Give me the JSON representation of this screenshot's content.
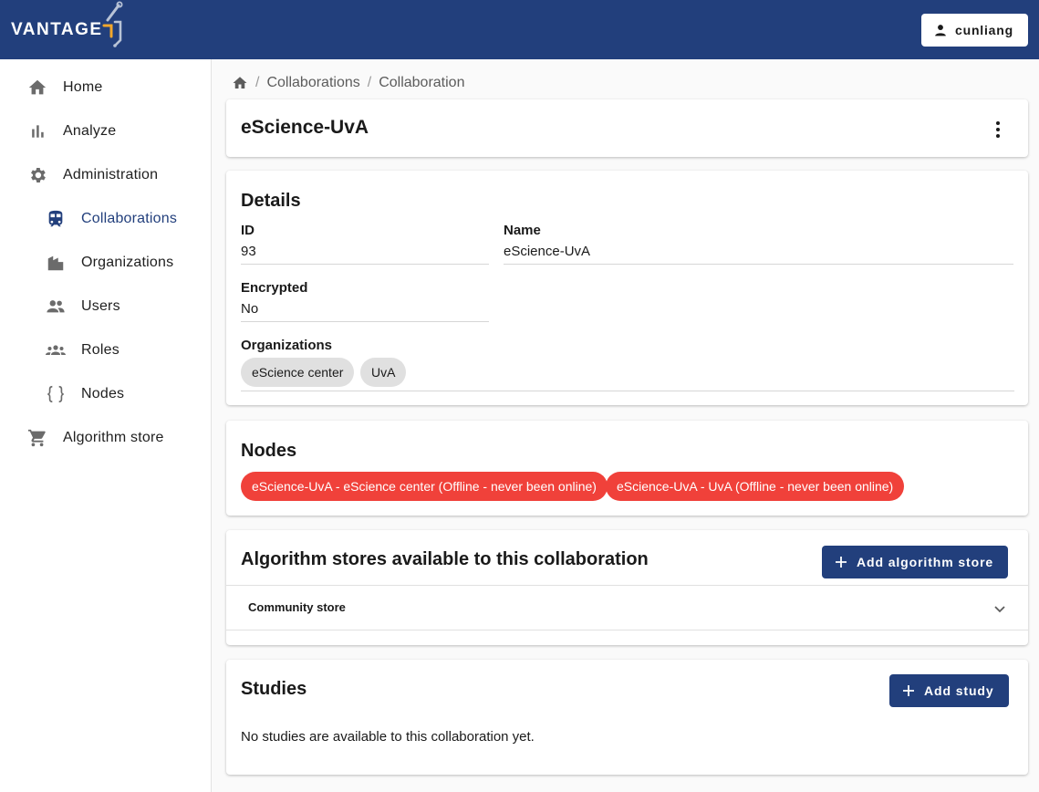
{
  "app": {
    "logo_text": "VANTAGE"
  },
  "header": {
    "user_label": "cunliang"
  },
  "colors": {
    "brand": "#223f7c",
    "offline": "#f0413a",
    "chip": "#e0e0e0"
  },
  "sidebar": {
    "items": [
      {
        "label": "Home",
        "icon": "home-icon"
      },
      {
        "label": "Analyze",
        "icon": "bar-chart-icon"
      },
      {
        "label": "Administration",
        "icon": "gear-icon"
      },
      {
        "label": "Collaborations",
        "icon": "train-icon",
        "active": true
      },
      {
        "label": "Organizations",
        "icon": "building-icon"
      },
      {
        "label": "Users",
        "icon": "people-icon"
      },
      {
        "label": "Roles",
        "icon": "groups-icon"
      },
      {
        "label": "Nodes",
        "icon": "braces-icon"
      },
      {
        "label": "Algorithm store",
        "icon": "cart-icon"
      }
    ]
  },
  "breadcrumb": {
    "items": [
      "Collaborations",
      "Collaboration"
    ]
  },
  "collaboration": {
    "title": "eScience-UvA"
  },
  "details": {
    "heading": "Details",
    "id_label": "ID",
    "id_value": "93",
    "name_label": "Name",
    "name_value": "eScience-UvA",
    "encrypted_label": "Encrypted",
    "encrypted_value": "No",
    "organizations_label": "Organizations",
    "organizations": [
      "eScience center",
      "UvA"
    ]
  },
  "nodes": {
    "heading": "Nodes",
    "items": [
      "eScience-UvA - eScience center (Offline - never been online)",
      "eScience-UvA - UvA (Offline - never been online)"
    ]
  },
  "algorithm_stores": {
    "heading": "Algorithm stores available to this collaboration",
    "add_button": "Add algorithm store",
    "stores": [
      "Community store"
    ]
  },
  "studies": {
    "heading": "Studies",
    "add_button": "Add study",
    "empty_text": "No studies are available to this collaboration yet."
  }
}
